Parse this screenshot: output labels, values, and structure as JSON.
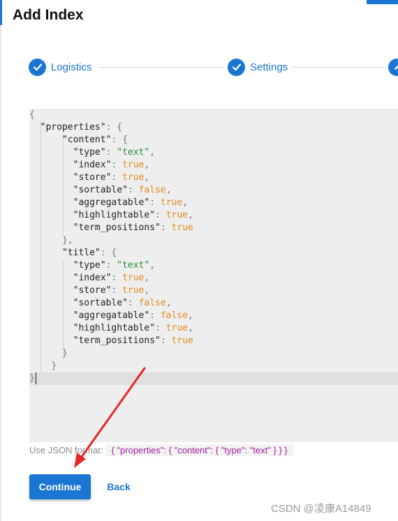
{
  "dialog": {
    "title": "Add Index"
  },
  "stepper": {
    "steps": [
      {
        "label": "Logistics",
        "icon": "check-icon"
      },
      {
        "label": "Settings",
        "icon": "check-icon"
      },
      {
        "label": "",
        "icon": "pencil-icon"
      }
    ]
  },
  "editor": {
    "lines": [
      [
        [
          "pun",
          "{"
        ]
      ],
      [
        [
          "sp",
          "  "
        ],
        [
          "key",
          "\"properties\""
        ],
        [
          "pun",
          ": {"
        ]
      ],
      [
        [
          "sp",
          "      "
        ],
        [
          "key",
          "\"content\""
        ],
        [
          "pun",
          ": {"
        ]
      ],
      [
        [
          "sp",
          "        "
        ],
        [
          "key",
          "\"type\""
        ],
        [
          "pun",
          ": "
        ],
        [
          "str",
          "\"text\""
        ],
        [
          "pun",
          ","
        ]
      ],
      [
        [
          "sp",
          "        "
        ],
        [
          "key",
          "\"index\""
        ],
        [
          "pun",
          ": "
        ],
        [
          "kw",
          "true"
        ],
        [
          "pun",
          ","
        ]
      ],
      [
        [
          "sp",
          "        "
        ],
        [
          "key",
          "\"store\""
        ],
        [
          "pun",
          ": "
        ],
        [
          "kw",
          "true"
        ],
        [
          "pun",
          ","
        ]
      ],
      [
        [
          "sp",
          "        "
        ],
        [
          "key",
          "\"sortable\""
        ],
        [
          "pun",
          ": "
        ],
        [
          "kw",
          "false"
        ],
        [
          "pun",
          ","
        ]
      ],
      [
        [
          "sp",
          "        "
        ],
        [
          "key",
          "\"aggregatable\""
        ],
        [
          "pun",
          ": "
        ],
        [
          "kw",
          "true"
        ],
        [
          "pun",
          ","
        ]
      ],
      [
        [
          "sp",
          "        "
        ],
        [
          "key",
          "\"highlightable\""
        ],
        [
          "pun",
          ": "
        ],
        [
          "kw",
          "true"
        ],
        [
          "pun",
          ","
        ]
      ],
      [
        [
          "sp",
          "        "
        ],
        [
          "key",
          "\"term_positions\""
        ],
        [
          "pun",
          ": "
        ],
        [
          "kw",
          "true"
        ]
      ],
      [
        [
          "sp",
          "      "
        ],
        [
          "pun",
          "},"
        ]
      ],
      [
        [
          "sp",
          "      "
        ],
        [
          "key",
          "\"title\""
        ],
        [
          "pun",
          ": {"
        ]
      ],
      [
        [
          "sp",
          "        "
        ],
        [
          "key",
          "\"type\""
        ],
        [
          "pun",
          ": "
        ],
        [
          "str",
          "\"text\""
        ],
        [
          "pun",
          ","
        ]
      ],
      [
        [
          "sp",
          "        "
        ],
        [
          "key",
          "\"index\""
        ],
        [
          "pun",
          ": "
        ],
        [
          "kw",
          "true"
        ],
        [
          "pun",
          ","
        ]
      ],
      [
        [
          "sp",
          "        "
        ],
        [
          "key",
          "\"store\""
        ],
        [
          "pun",
          ": "
        ],
        [
          "kw",
          "true"
        ],
        [
          "pun",
          ","
        ]
      ],
      [
        [
          "sp",
          "        "
        ],
        [
          "key",
          "\"sortable\""
        ],
        [
          "pun",
          ": "
        ],
        [
          "kw",
          "false"
        ],
        [
          "pun",
          ","
        ]
      ],
      [
        [
          "sp",
          "        "
        ],
        [
          "key",
          "\"aggregatable\""
        ],
        [
          "pun",
          ": "
        ],
        [
          "kw",
          "false"
        ],
        [
          "pun",
          ","
        ]
      ],
      [
        [
          "sp",
          "        "
        ],
        [
          "key",
          "\"highlightable\""
        ],
        [
          "pun",
          ": "
        ],
        [
          "kw",
          "true"
        ],
        [
          "pun",
          ","
        ]
      ],
      [
        [
          "sp",
          "        "
        ],
        [
          "key",
          "\"term_positions\""
        ],
        [
          "pun",
          ": "
        ],
        [
          "kw",
          "true"
        ]
      ],
      [
        [
          "sp",
          "      "
        ],
        [
          "pun",
          "}"
        ]
      ],
      [
        [
          "sp",
          "    "
        ],
        [
          "pun",
          "}"
        ]
      ],
      [
        [
          "pun",
          "}"
        ]
      ]
    ]
  },
  "hint": {
    "prefix": "Use JSON format:",
    "example": "{ \"properties\": { \"content\": { \"type\": \"text\" } } }"
  },
  "actions": {
    "continue_label": "Continue",
    "back_label": "Back"
  },
  "watermark": "CSDN @凌康A14849",
  "colors": {
    "primary": "#1976d2",
    "annotation_arrow": "#e8262a"
  }
}
